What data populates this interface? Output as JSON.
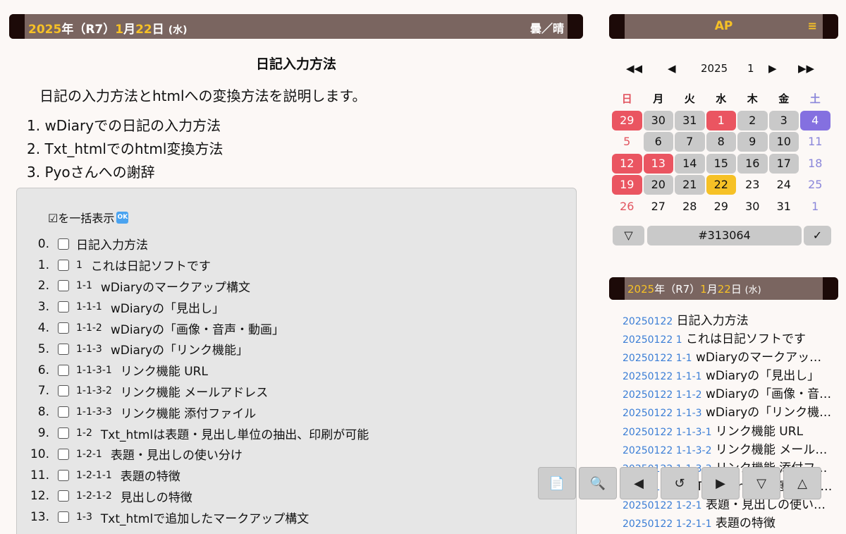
{
  "header": {
    "year": "2025",
    "era": "年（R7）",
    "month": "1",
    "month_suffix": "月",
    "day": "22",
    "day_suffix": "日",
    "dow": "(水)",
    "weather": "曇／晴"
  },
  "side_header": {
    "title": "AP",
    "menu": "≡"
  },
  "article": {
    "title": "日記入力方法",
    "intro": "日記の入力方法とhtmlへの変換方法を説明します。",
    "toc": [
      "1. wDiaryでの日記の入力方法",
      "2. Txt_htmlでのhtml変換方法",
      "3. Pyoさんへの謝辞"
    ]
  },
  "panel": {
    "toggle_label": "☑を一括表示",
    "ok_icon": "OK",
    "items": [
      {
        "num": "0.",
        "sec": "",
        "text": "日記入力方法"
      },
      {
        "num": "1.",
        "sec": "1",
        "text": "これは日記ソフトです"
      },
      {
        "num": "2.",
        "sec": "1-1",
        "text": "wDiaryのマークアップ構文"
      },
      {
        "num": "3.",
        "sec": "1-1-1",
        "text": "wDiaryの「見出し」"
      },
      {
        "num": "4.",
        "sec": "1-1-2",
        "text": "wDiaryの「画像・音声・動画」"
      },
      {
        "num": "5.",
        "sec": "1-1-3",
        "text": "wDiaryの「リンク機能」"
      },
      {
        "num": "6.",
        "sec": "1-1-3-1",
        "text": "リンク機能 URL"
      },
      {
        "num": "7.",
        "sec": "1-1-3-2",
        "text": "リンク機能 メールアドレス"
      },
      {
        "num": "8.",
        "sec": "1-1-3-3",
        "text": "リンク機能 添付ファイル"
      },
      {
        "num": "9.",
        "sec": "1-2",
        "text": "Txt_htmlは表題・見出し単位の抽出、印刷が可能"
      },
      {
        "num": "10.",
        "sec": "1-2-1",
        "text": "表題・見出しの使い分け"
      },
      {
        "num": "11.",
        "sec": "1-2-1-1",
        "text": "表題の特徴"
      },
      {
        "num": "12.",
        "sec": "1-2-1-2",
        "text": "見出しの特徴"
      },
      {
        "num": "13.",
        "sec": "1-3",
        "text": "Txt_htmlで追加したマークアップ構文"
      }
    ]
  },
  "calendar": {
    "nav": {
      "prev_year": "◀◀",
      "prev_month": "◀",
      "year": "2025",
      "month": "1",
      "next_month": "▶",
      "next_year": "▶▶"
    },
    "dow": [
      "日",
      "月",
      "火",
      "水",
      "木",
      "金",
      "土"
    ],
    "weeks": [
      [
        {
          "d": "29",
          "s": "red"
        },
        {
          "d": "30",
          "s": "grey"
        },
        {
          "d": "31",
          "s": "grey"
        },
        {
          "d": "1",
          "s": "red"
        },
        {
          "d": "2",
          "s": "grey"
        },
        {
          "d": "3",
          "s": "grey"
        },
        {
          "d": "4",
          "s": "purple"
        }
      ],
      [
        {
          "d": "5",
          "s": "tred"
        },
        {
          "d": "6",
          "s": "grey"
        },
        {
          "d": "7",
          "s": "grey"
        },
        {
          "d": "8",
          "s": "grey"
        },
        {
          "d": "9",
          "s": "grey"
        },
        {
          "d": "10",
          "s": "grey"
        },
        {
          "d": "11",
          "s": "tblue"
        }
      ],
      [
        {
          "d": "12",
          "s": "red"
        },
        {
          "d": "13",
          "s": "red"
        },
        {
          "d": "14",
          "s": "grey"
        },
        {
          "d": "15",
          "s": "grey"
        },
        {
          "d": "16",
          "s": "grey"
        },
        {
          "d": "17",
          "s": "grey"
        },
        {
          "d": "18",
          "s": "tblue"
        }
      ],
      [
        {
          "d": "19",
          "s": "red"
        },
        {
          "d": "20",
          "s": "grey"
        },
        {
          "d": "21",
          "s": "grey"
        },
        {
          "d": "22",
          "s": "yellow"
        },
        {
          "d": "23",
          "s": ""
        },
        {
          "d": "24",
          "s": ""
        },
        {
          "d": "25",
          "s": "tblue"
        }
      ],
      [
        {
          "d": "26",
          "s": "tred"
        },
        {
          "d": "27",
          "s": ""
        },
        {
          "d": "28",
          "s": ""
        },
        {
          "d": "29",
          "s": ""
        },
        {
          "d": "30",
          "s": ""
        },
        {
          "d": "31",
          "s": ""
        },
        {
          "d": "1",
          "s": "tblue"
        }
      ]
    ],
    "tools": {
      "dropdown": "▽",
      "color": "#313064",
      "confirm": "✓"
    }
  },
  "list_header": {
    "year": "2025",
    "era": "年（R7）",
    "month": "1",
    "month_suffix": "月",
    "day": "22",
    "day_suffix": "日",
    "dow": "(水)"
  },
  "entries": [
    {
      "code": "20250122",
      "text": "日記入力方法"
    },
    {
      "code": "20250122 1",
      "text": "これは日記ソフトです"
    },
    {
      "code": "20250122 1-1",
      "text": "wDiaryのマークアップ構文"
    },
    {
      "code": "20250122 1-1-1",
      "text": "wDiaryの「見出し」"
    },
    {
      "code": "20250122 1-1-2",
      "text": "wDiaryの「画像・音声・動画」"
    },
    {
      "code": "20250122 1-1-3",
      "text": "wDiaryの「リンク機能」"
    },
    {
      "code": "20250122 1-1-3-1",
      "text": "リンク機能 URL"
    },
    {
      "code": "20250122 1-1-3-2",
      "text": "リンク機能 メールアドレス"
    },
    {
      "code": "20250122 1-1-3-3",
      "text": "リンク機能 添付ファイル"
    },
    {
      "code": "20250122 1-2",
      "text": "Txt_htmlは表題・見出し単位の抽出、印刷が可能"
    },
    {
      "code": "20250122 1-2-1",
      "text": "表題・見出しの使い分け"
    },
    {
      "code": "20250122 1-2-1-1",
      "text": "表題の特徴"
    }
  ],
  "toolbar": {
    "doc": "📄",
    "search": "🔍",
    "prev": "◀",
    "reload": "↺",
    "next": "▶",
    "down": "▽",
    "up": "△"
  }
}
